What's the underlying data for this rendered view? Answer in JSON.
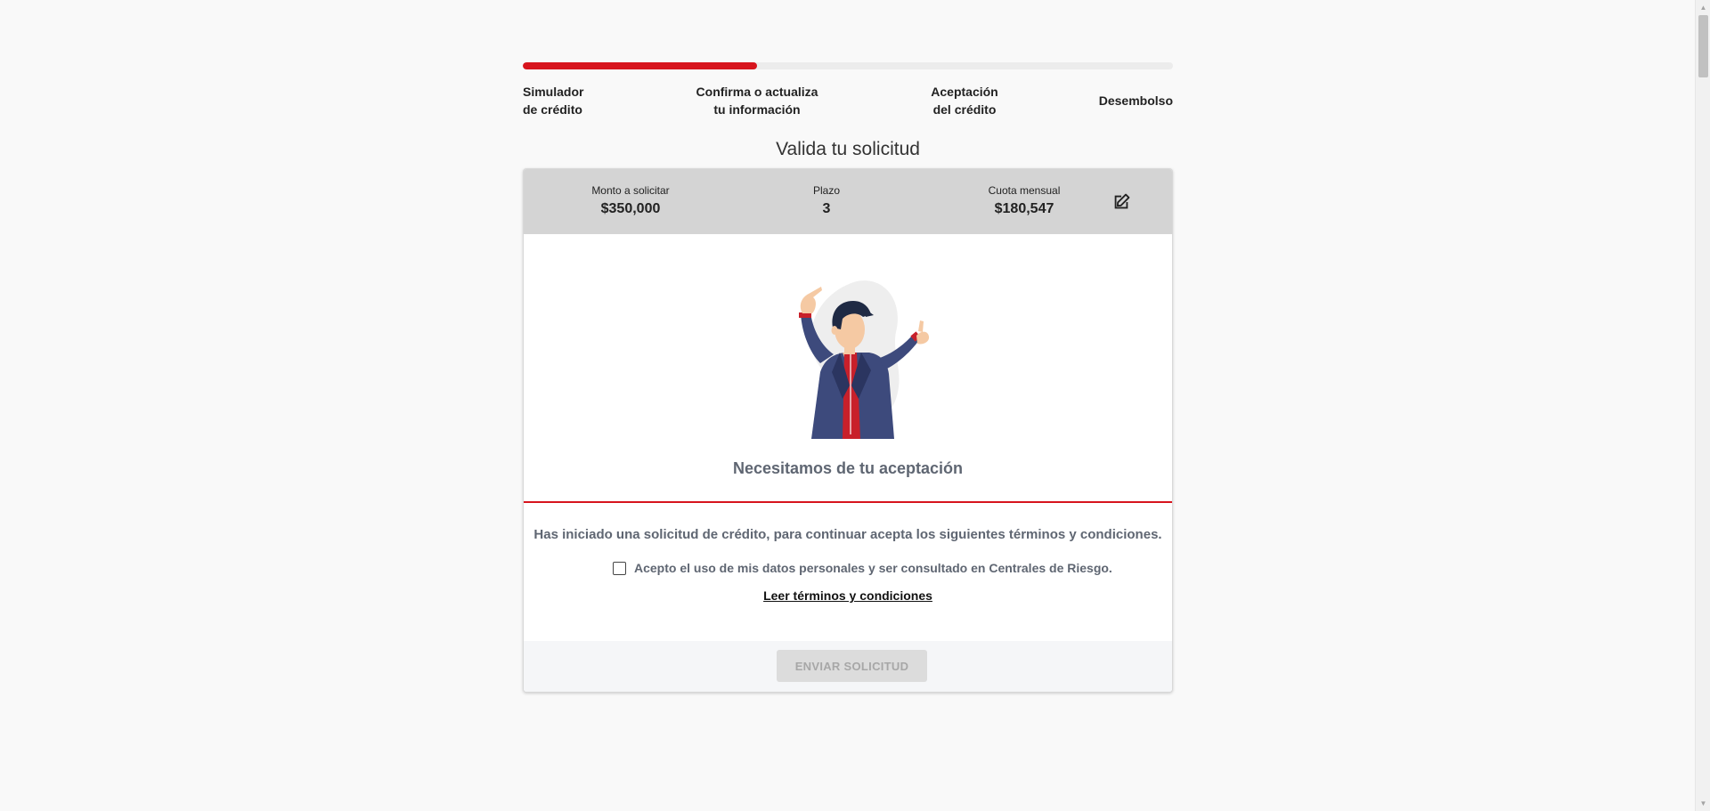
{
  "progress": {
    "value_percent": 36,
    "accent_color": "#d7141d"
  },
  "steps": [
    {
      "line1": "Simulador",
      "line2": "de crédito"
    },
    {
      "line1": "Confirma o actualiza",
      "line2": "tu información"
    },
    {
      "line1": "Aceptación",
      "line2": "del crédito"
    },
    {
      "line1": "Desembolso"
    }
  ],
  "page_title": "Valida tu solicitud",
  "summary": {
    "monto_label": "Monto a solicitar",
    "monto_value": "$350,000",
    "plazo_label": "Plazo",
    "plazo_value": "3",
    "cuota_label": "Cuota mensual",
    "cuota_value": "$180,547",
    "edit_icon": "edit-icon"
  },
  "acceptance": {
    "heading": "Necesitamos de tu aceptación",
    "terms_text": "Has iniciado una solicitud de crédito, para continuar acepta los siguientes términos y condiciones.",
    "checkbox_label": "Acepto el uso de mis datos personales y ser consultado en Centrales de Riesgo.",
    "checkbox_checked": false,
    "read_link": "Leer términos y condiciones"
  },
  "submit": {
    "label": "ENVIAR SOLICITUD",
    "disabled": true
  }
}
